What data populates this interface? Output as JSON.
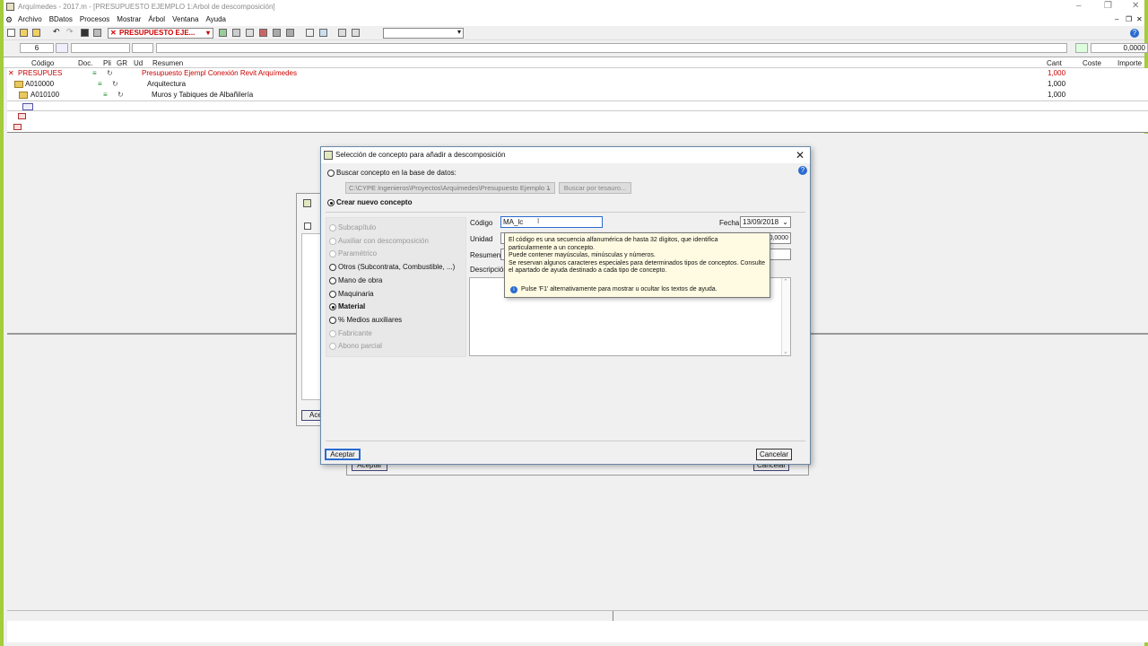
{
  "window": {
    "title": "Arquímedes - 2017.m - [PRESUPUESTO EJEMPLO 1:Arbol de descomposición]",
    "controls": {
      "minimize": "–",
      "maximize": "❐",
      "close": "✕"
    },
    "mdi_controls": {
      "minimize": "–",
      "restore": "❐",
      "close": "✕"
    }
  },
  "menu": [
    "Archivo",
    "BDatos",
    "Procesos",
    "Mostrar",
    "Árbol",
    "Ventana",
    "Ayuda"
  ],
  "toolbar": {
    "budget_selector": "PRESUPUESTO EJE...",
    "help_icon": "?"
  },
  "field_row": {
    "level": "6",
    "right_value": "0,0000"
  },
  "tree": {
    "columns": [
      "Código",
      "Doc.",
      "Pli",
      "GR",
      "Ud",
      "Resumen",
      "Cant",
      "Coste",
      "Importe"
    ],
    "rows": [
      {
        "code": "PRESUPUES",
        "summary": "Presupuesto Ejempl Conexión Revit Arquímedes",
        "qty": "1,000",
        "root": true
      },
      {
        "code": "A010000",
        "summary": "Arquitectura",
        "qty": "1,000"
      },
      {
        "code": "A010100",
        "summary": "Muros y Tabiques de Albañilería",
        "qty": "1,000"
      }
    ]
  },
  "background_dialog": {
    "accept": "Aceptar",
    "cancel": "Cancelar",
    "partial_accept": "Ace"
  },
  "dialog": {
    "title": "Selección de concepto para añadir a descomposición",
    "close": "✕",
    "help": "?",
    "search_option": "Buscar concepto en la base de datos:",
    "path": "C:\\CYPE Ingenieros\\Proyectos\\Arquimedes\\Presupuesto Ejemplo 1",
    "thesaurus_button": "Buscar por tesauro...",
    "create_option": "Crear nuevo concepto",
    "types": [
      {
        "label": "Subcapítulo",
        "enabled": false,
        "selected": false
      },
      {
        "label": "Auxiliar con descomposición",
        "enabled": false,
        "selected": false
      },
      {
        "label": "Paramétrico",
        "enabled": false,
        "selected": false
      },
      {
        "label": "Otros (Subcontrata, Combustible, ...)",
        "enabled": true,
        "selected": false
      },
      {
        "label": "Mano de obra",
        "enabled": true,
        "selected": false
      },
      {
        "label": "Maquinaria",
        "enabled": true,
        "selected": false
      },
      {
        "label": "Material",
        "enabled": true,
        "selected": true
      },
      {
        "label": "% Medios auxiliares",
        "enabled": true,
        "selected": false
      },
      {
        "label": "Fabricante",
        "enabled": false,
        "selected": false
      },
      {
        "label": "Abono parcial",
        "enabled": false,
        "selected": false
      }
    ],
    "code_label": "Código",
    "code_value": "MA_lc",
    "date_label": "Fecha",
    "date_value": "13/09/2018",
    "unit_label": "Unidad",
    "price_partial": "0,0000",
    "summary_label": "Resumen",
    "description_label": "Descripción",
    "tooltip": {
      "lines": [
        "El código es una secuencia alfanumérica de hasta 32 dígitos, que identifica",
        "particularmente a un concepto.",
        "Puede contener mayúsculas, minúsculas y números.",
        "Se reservan algunos caracteres especiales para determinados tipos de conceptos. Consulte",
        "el apartado de ayuda destinado a cada tipo de concepto."
      ],
      "hint": "Pulse 'F1' alternativamente para mostrar u ocultar los textos de ayuda."
    },
    "accept": "Aceptar",
    "cancel": "Cancelar"
  }
}
